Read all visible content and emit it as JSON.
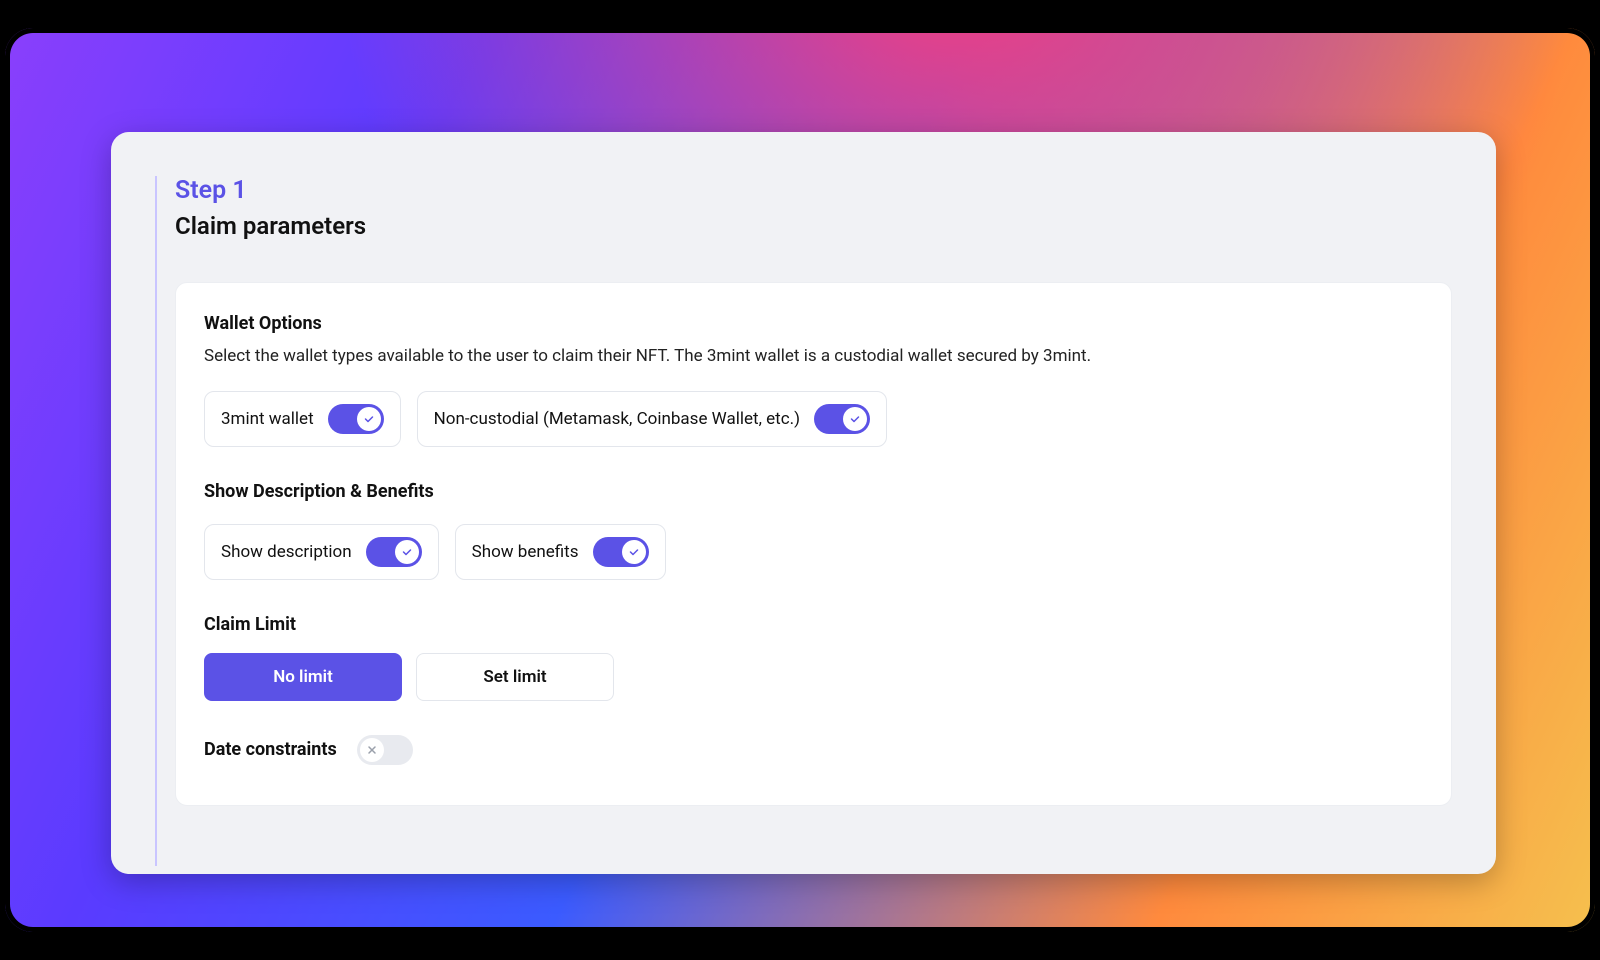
{
  "header": {
    "step_label": "Step 1",
    "title": "Claim parameters"
  },
  "wallet": {
    "title": "Wallet Options",
    "desc": "Select the wallet types available to the user to claim their NFT. The 3mint wallet is a custodial wallet secured by 3mint.",
    "opt1_label": "3mint wallet",
    "opt2_label": "Non-custodial (Metamask, Coinbase Wallet, etc.)"
  },
  "showdb": {
    "title": "Show Description & Benefits",
    "opt1_label": "Show description",
    "opt2_label": "Show benefits"
  },
  "claim_limit": {
    "title": "Claim Limit",
    "no_limit": "No limit",
    "set_limit": "Set limit"
  },
  "date_constraints": {
    "title": "Date constraints"
  }
}
